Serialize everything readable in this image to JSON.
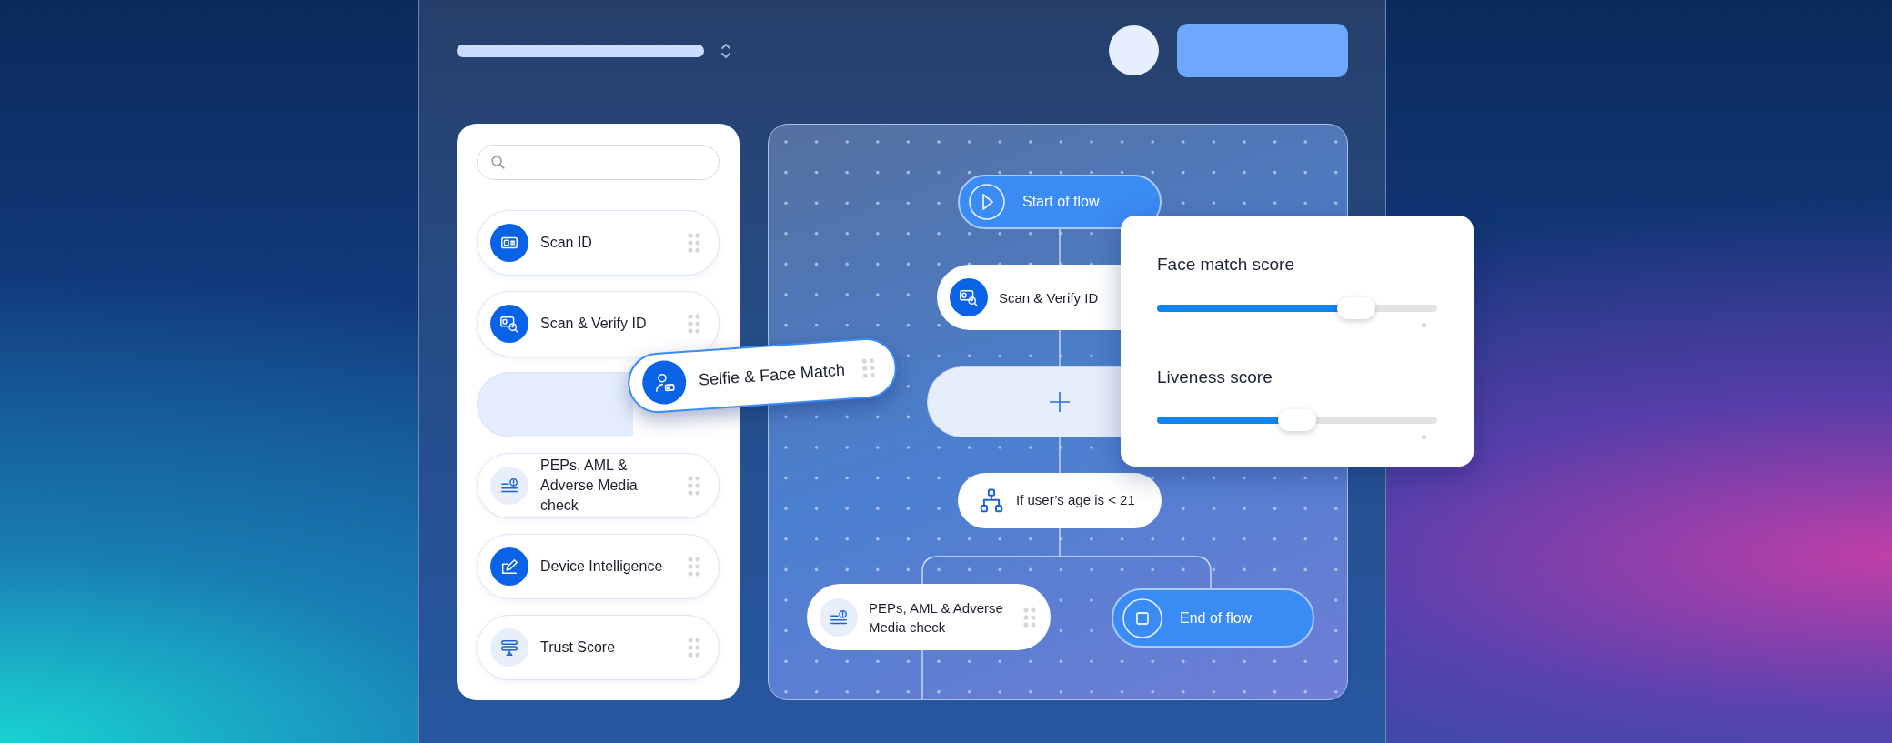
{
  "sidebar": {
    "items": [
      {
        "kind": "id-card",
        "label": "Scan ID"
      },
      {
        "kind": "id-verify",
        "label": "Scan & Verify ID"
      },
      {
        "kind": "slot"
      },
      {
        "kind": "aml",
        "label": "PEPs, AML & Adverse Media check"
      },
      {
        "kind": "device",
        "label": "Device Intelligence"
      },
      {
        "kind": "trust",
        "label": "Trust Score"
      }
    ]
  },
  "dragged_item": {
    "kind": "selfie",
    "label": "Selfie & Face Match"
  },
  "flow": {
    "nodes": [
      {
        "kind": "start",
        "label": "Start of flow"
      },
      {
        "kind": "id-verify",
        "label": "Scan & Verify ID"
      },
      {
        "kind": "slot"
      },
      {
        "kind": "condition",
        "label": "If user’s age is < 21"
      },
      {
        "kind": "aml",
        "label": "PEPs, AML & Adverse Media check"
      },
      {
        "kind": "end",
        "label": "End of flow"
      }
    ]
  },
  "settings": {
    "sliders": [
      {
        "label": "Face match score",
        "level": 0.71
      },
      {
        "label": "Liveness score",
        "level": 0.5
      }
    ]
  }
}
